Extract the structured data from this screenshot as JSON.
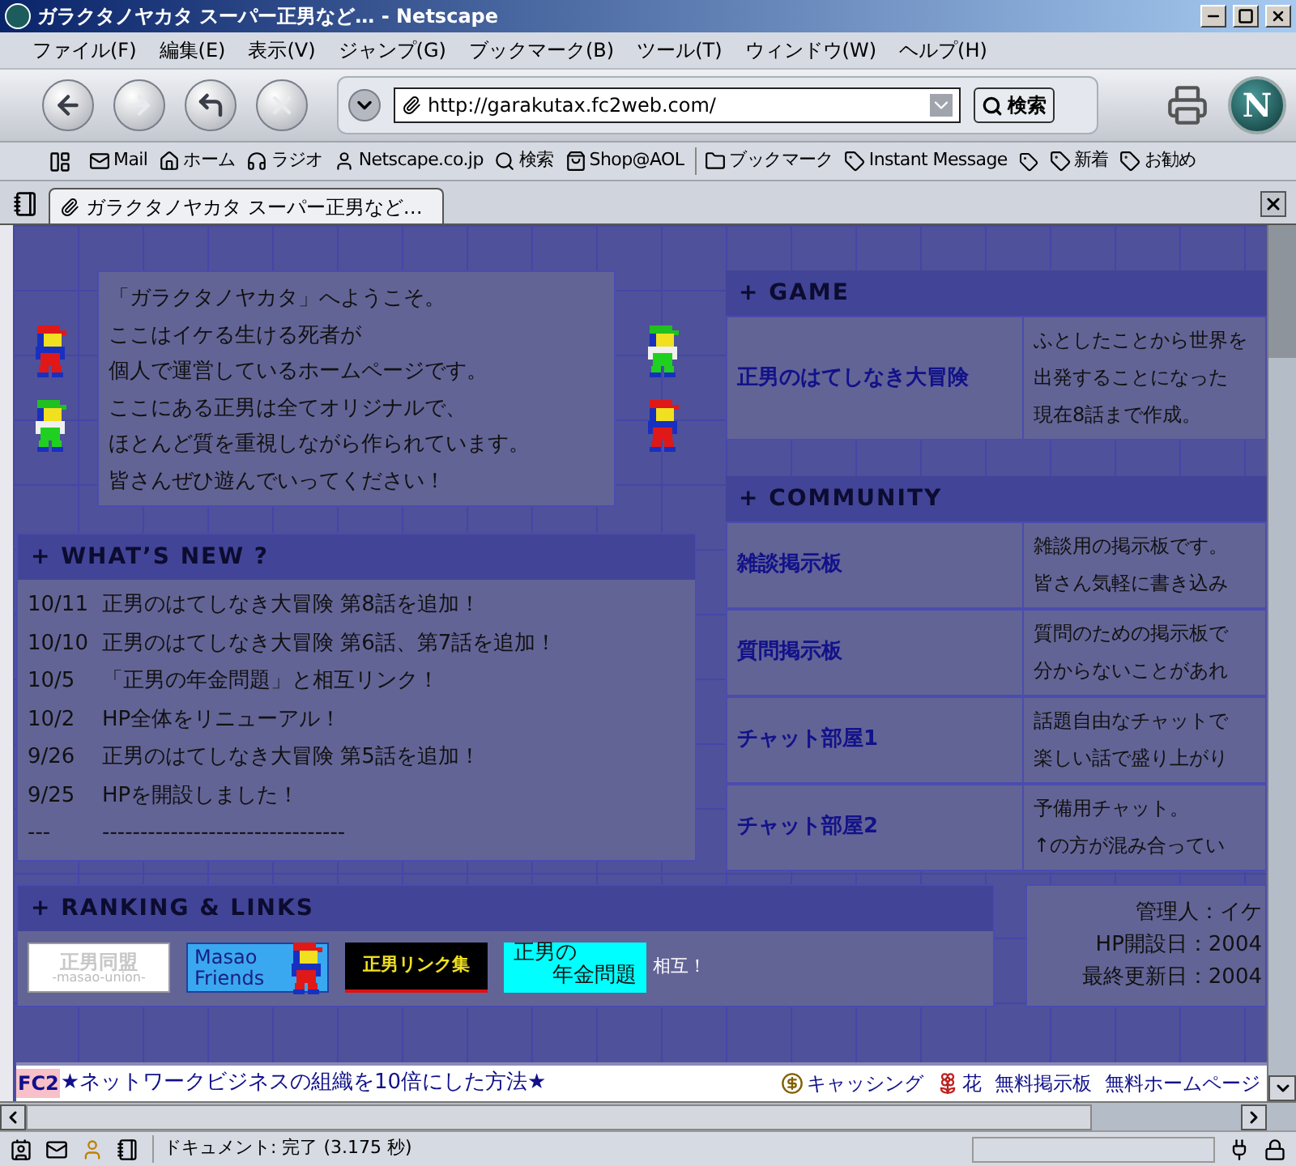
{
  "window": {
    "title": "ガラクタノヤカタ スーパー正男など… - Netscape"
  },
  "menu": [
    "ファイル(F)",
    "編集(E)",
    "表示(V)",
    "ジャンプ(G)",
    "ブックマーク(B)",
    "ツール(T)",
    "ウィンドウ(W)",
    "ヘルプ(H)"
  ],
  "address": {
    "value": "http://garakutax.fc2web.com/"
  },
  "search_button": "検索",
  "logo": "N",
  "personal_toolbar": [
    "Mail",
    "ホーム",
    "ラジオ",
    "Netscape.co.jp",
    "検索",
    "Shop@AOL",
    "ブックマーク",
    "Instant Message",
    "新着",
    "お勧め"
  ],
  "tab": {
    "label": "ガラクタノヤカタ スーパー正男など…"
  },
  "welcome": {
    "lines": [
      "「ガラクタノヤカタ」へようこそ。",
      "ここはイケる生ける死者が",
      "個人で運営しているホームページです。",
      "ここにある正男は全てオリジナルで、",
      "ほとんど質を重視しながら作られています。",
      "皆さんぜひ遊んでいってください！"
    ]
  },
  "whats_new": {
    "title": "+ WHAT’S NEW ?",
    "items": [
      {
        "date": "10/11",
        "text": "正男のはてしなき大冒険 第8話を追加！"
      },
      {
        "date": "10/10",
        "text": "正男のはてしなき大冒険 第6話、第7話を追加！"
      },
      {
        "date": "10/5",
        "text": "「正男の年金問題」と相互リンク！"
      },
      {
        "date": "10/2",
        "text": "HP全体をリニューアル！"
      },
      {
        "date": "9/26",
        "text": "正男のはてしなき大冒険 第5話を追加！"
      },
      {
        "date": "9/25",
        "text": "HPを開設しました！"
      },
      {
        "date": "---",
        "text": "--------------------------------"
      }
    ]
  },
  "game": {
    "title": "+ GAME",
    "rows": [
      {
        "name": "正男のはてしなき大冒険",
        "description": [
          "ふとしたことから世界を",
          "出発することになった",
          "現在8話まで作成。"
        ]
      }
    ]
  },
  "community": {
    "title": "+ COMMUNITY",
    "rows": [
      {
        "name": "雑談掲示板",
        "description": [
          "雑談用の掲示板です。",
          "皆さん気軽に書き込み"
        ]
      },
      {
        "name": "質問掲示板",
        "description": [
          "質問のための掲示板で",
          "分からないことがあれ"
        ]
      },
      {
        "name": "チャット部屋1",
        "description": [
          "話題自由なチャットで",
          "楽しい話で盛り上がり"
        ]
      },
      {
        "name": "チャット部屋2",
        "description": [
          "予備用チャット。",
          "↑の方が混み合ってい"
        ]
      }
    ]
  },
  "ranking": {
    "title": "+ RANKING & LINKS",
    "banners": [
      {
        "kind": "union",
        "lines": [
          "正男同盟",
          "-masao-union-"
        ]
      },
      {
        "kind": "friends",
        "lines": [
          "Masao",
          "Friends"
        ]
      },
      {
        "kind": "links",
        "lines": [
          "正男リンク集"
        ]
      },
      {
        "kind": "nenkin",
        "lines": [
          "正男の",
          "年金問題"
        ]
      }
    ],
    "note": "相互！"
  },
  "admin": {
    "lines": [
      "管理人：イケ",
      "HP開設日：2004",
      "最終更新日：2004"
    ]
  },
  "ad_bar": {
    "logo": "FC2",
    "text": "★ネットワークビジネスの組織を10倍にした方法★",
    "links": [
      "キャッシング",
      "花",
      "無料掲示板",
      "無料ホームページ"
    ]
  },
  "status": {
    "text": "ドキュメント: 完了 (3.175 秒)"
  }
}
